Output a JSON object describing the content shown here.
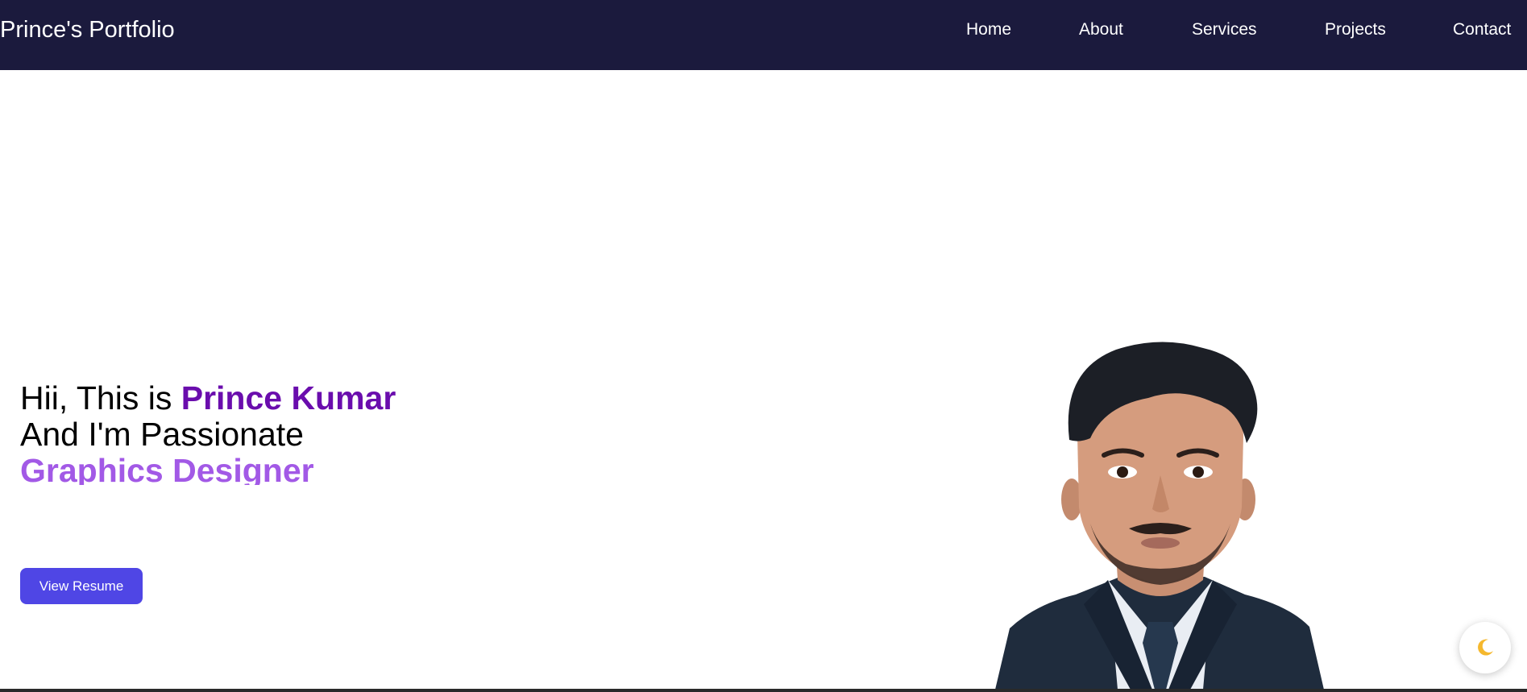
{
  "header": {
    "brand": "Prince's Portfolio",
    "nav": [
      {
        "label": "Home"
      },
      {
        "label": "About"
      },
      {
        "label": "Services"
      },
      {
        "label": "Projects"
      },
      {
        "label": "Contact"
      }
    ]
  },
  "hero": {
    "greeting": "Hii, This is ",
    "name": "Prince Kumar",
    "passion_line": "And I'm Passionate",
    "role": "Graphics Designer",
    "resume_button": "View Resume"
  },
  "portrait": {
    "icon": "person-portrait"
  },
  "theme_toggle": {
    "icon": "moon-icon"
  },
  "colors": {
    "nav_background": "#1b1a3d",
    "name_accent": "#6a0dad",
    "role_accent": "#a259e6",
    "button_background": "#4f46e5",
    "moon": "#f5b82e"
  }
}
